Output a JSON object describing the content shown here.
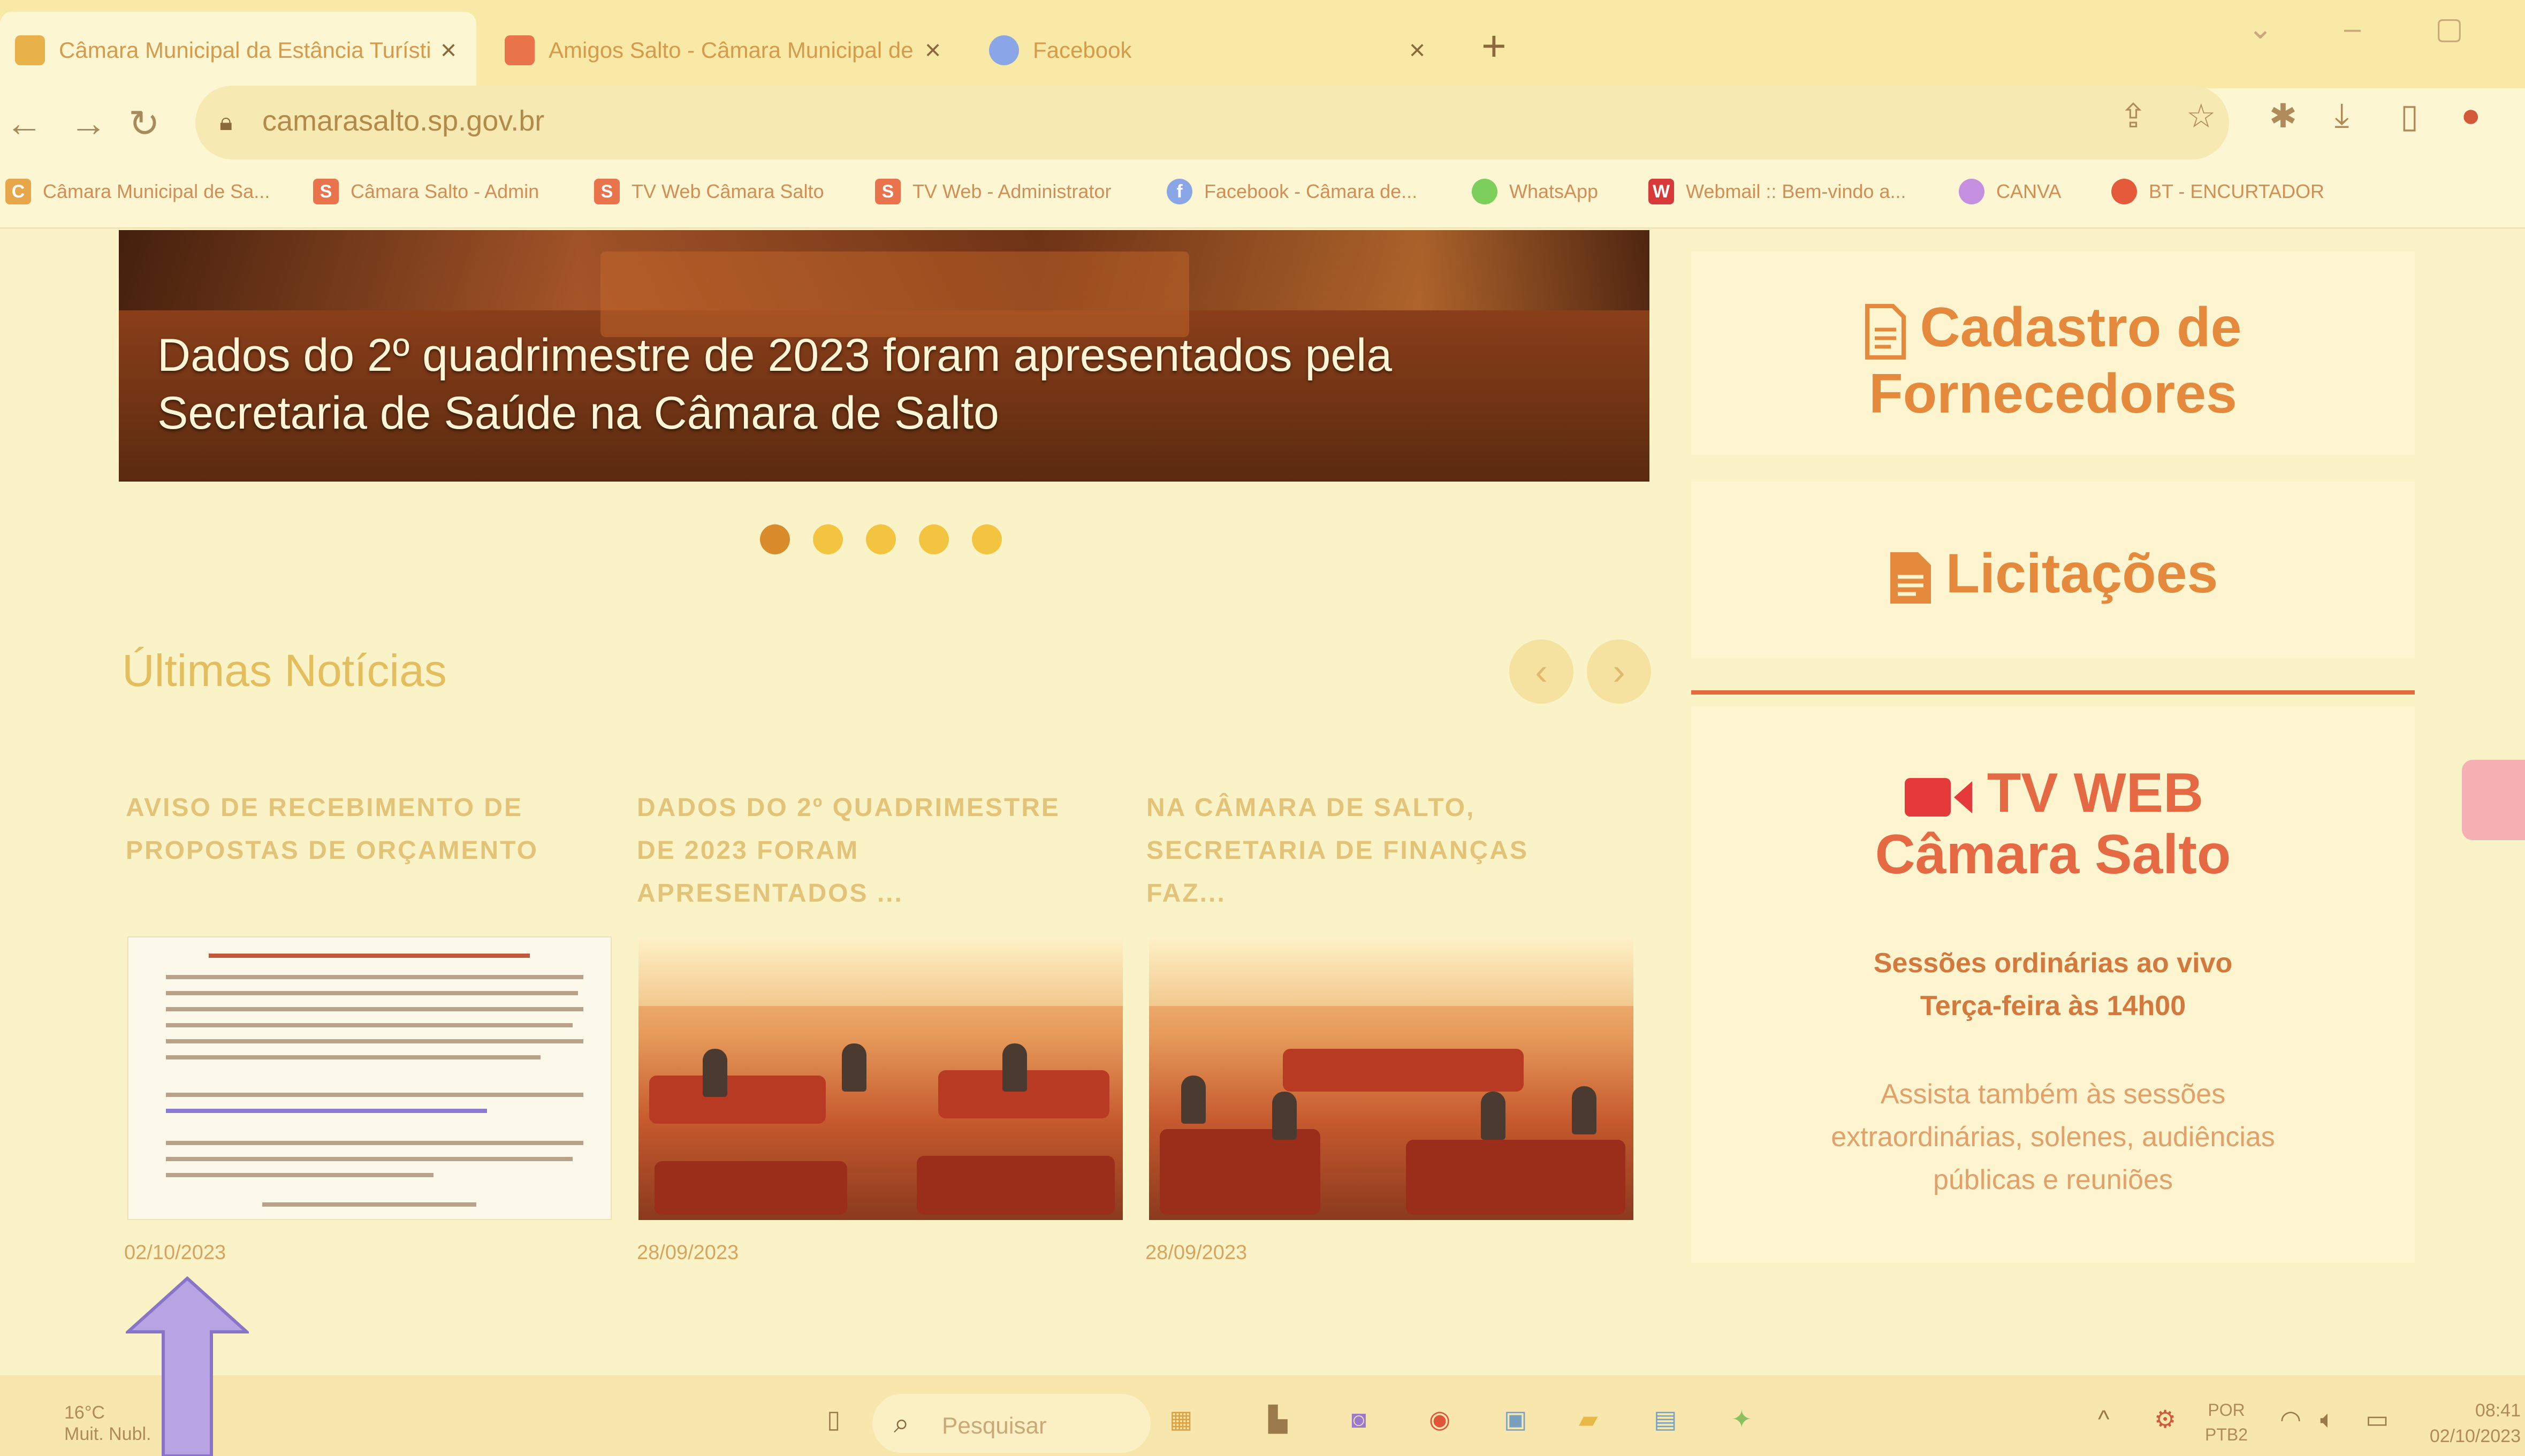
{
  "browser": {
    "tabs": [
      {
        "title": "Câmara Municipal da Estância Turísti",
        "active": true
      },
      {
        "title": "Amigos Salto - Câmara Municipal de",
        "active": false
      },
      {
        "title": "Facebook",
        "active": false
      }
    ],
    "url": "camarasalto.sp.gov.br",
    "bookmarks": [
      "Câmara Municipal de Sa...",
      "Câmara Salto - Admin",
      "TV Web Câmara Salto",
      "TV Web - Administrator",
      "Facebook - Câmara de...",
      "WhatsApp",
      "Webmail :: Bem-vindo a...",
      "CANVA",
      "BT - ENCURTADOR"
    ]
  },
  "hero": {
    "caption_line1": "Dados do 2º quadrimestre de 2023 foram apresentados pela",
    "caption_line2": "Secretaria de Saúde na Câmara de Salto",
    "slides_total": 5,
    "active_slide": 1
  },
  "news": {
    "heading": "Últimas Notícias",
    "items": [
      {
        "title": "AVISO DE RECEBIMENTO DE PROPOSTAS DE ORÇAMENTO",
        "date": "02/10/2023"
      },
      {
        "title": "DADOS DO 2º QUADRIMESTRE DE 2023 FORAM APRESENTADOS ...",
        "date": "28/09/2023"
      },
      {
        "title": "NA CÂMARA DE SALTO, SECRETARIA DE FINANÇAS FAZ...",
        "date": "28/09/2023"
      }
    ]
  },
  "sidebar": {
    "fornecedores_line1": "Cadastro de",
    "fornecedores_line2": "Fornecedores",
    "licitacoes": "Licitações",
    "tv_line1": "TV WEB",
    "tv_line2": "Câmara Salto",
    "sessions_line1": "Sessões ordinárias ao vivo",
    "sessions_line2": "Terça-feira às 14h00",
    "watch_line1": "Assista também às sessões",
    "watch_line2": "extraordinárias, solenes, audiências",
    "watch_line3": "públicas e reuniões"
  },
  "taskbar": {
    "weather_temp": "16°C",
    "weather_desc": "Muit. Nubl.",
    "search_placeholder": "Pesquisar",
    "lang_line1": "POR",
    "lang_line2": "PTB2",
    "time": "08:41",
    "date": "02/10/2023"
  },
  "colors": {
    "accent": "#e58a3c",
    "divider": "#e26a3c",
    "page_bg": "#fbf3c8"
  }
}
